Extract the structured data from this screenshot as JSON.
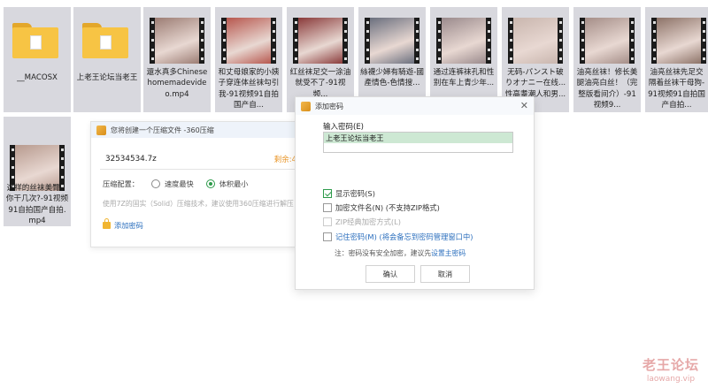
{
  "files": [
    {
      "kind": "folder",
      "name": "__MACOSX"
    },
    {
      "kind": "folder",
      "name": "上老王论坛当老王"
    },
    {
      "kind": "video",
      "name": "還水真多Chinesehomemadevideo.mp4",
      "thumb_color": "#9c7d74"
    },
    {
      "kind": "video",
      "name": "和丈母娘家的小姨子穿连体丝袜勾引我-91视频91自拍国产自...",
      "thumb_color": "#b7574e"
    },
    {
      "kind": "video",
      "name": "红丝袜足交一涂油就受不了-91视频...",
      "thumb_color": "#8a3a3a"
    },
    {
      "kind": "video",
      "name": "絲襪少婦有騎遊-國產情色-色情搜...",
      "thumb_color": "#6a6f7e"
    },
    {
      "kind": "video",
      "name": "通过连裤袜孔和性别在车上青少年...",
      "thumb_color": "#9a8a8c"
    },
    {
      "kind": "video",
      "name": "无码-パンスト破りオナニー在线...性高耋潮人和男...",
      "thumb_color": "#c9b6ae"
    },
    {
      "kind": "video",
      "name": "油亮丝袜！修长美腿油亮白丝！（完整版看间介）-91视频9...",
      "thumb_color": "#a58e88"
    },
    {
      "kind": "video",
      "name": "油亮丝袜先足交隔着丝袜干母狗-91视频91自拍国产自拍...",
      "thumb_color": "#8d7368"
    },
    {
      "kind": "video",
      "name": "这样的丝袜美臀，你干几次?-91视频91自拍国产自拍.mp4",
      "thumb_color": "#b79a8e"
    }
  ],
  "zip_dialog": {
    "title": "您将创建一个压缩文件 -360压缩",
    "filename": "32534534.7z",
    "remaining": "剩余:4",
    "config_label": "压缩配置：",
    "option_fast": "速度最快",
    "option_small": "体积最小",
    "hint": "使用7Z的固实（Solid）压缩技术，建议使用360压缩进行解压",
    "add_password": "添加密码"
  },
  "password_dialog": {
    "title": "添加密码",
    "input_label": "输入密码(E)",
    "password_value": "上老王论坛当老王",
    "show_password": "显示密码(S)",
    "encrypt_filenames": "加密文件名(N) (不支持ZIP格式)",
    "zip_classic": "ZIP经典加密方式(L)",
    "remember_password": "记住密码(M) (将会备忘到密码管理窗口中)",
    "note_prefix": "注：密码没有安全加密，建议先",
    "note_link": "设置主密码",
    "ok": "确认",
    "cancel": "取消",
    "close": "✕"
  },
  "watermark": {
    "title": "老王论坛",
    "url": "laowang.vip"
  },
  "colors": {
    "accent_green": "#2d9a4a",
    "link_blue": "#2a6ebd",
    "warning_orange": "#e9972b"
  }
}
